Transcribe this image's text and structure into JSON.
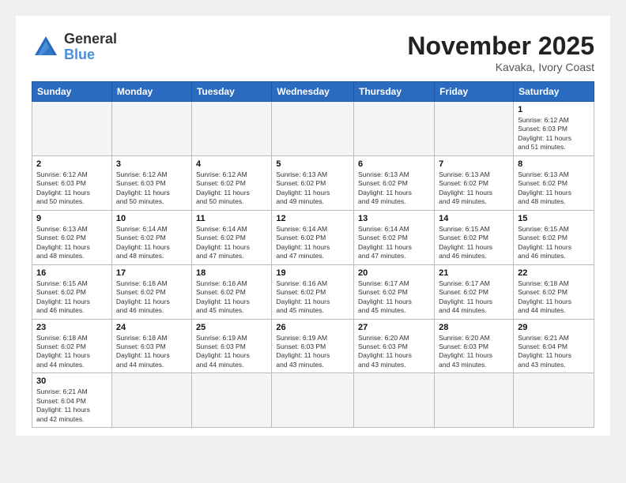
{
  "header": {
    "logo_general": "General",
    "logo_blue": "Blue",
    "month_title": "November 2025",
    "location": "Kavaka, Ivory Coast"
  },
  "weekdays": [
    "Sunday",
    "Monday",
    "Tuesday",
    "Wednesday",
    "Thursday",
    "Friday",
    "Saturday"
  ],
  "days": {
    "1": {
      "sunrise": "6:12 AM",
      "sunset": "6:03 PM",
      "daylight": "11 hours and 51 minutes."
    },
    "2": {
      "sunrise": "6:12 AM",
      "sunset": "6:03 PM",
      "daylight": "11 hours and 50 minutes."
    },
    "3": {
      "sunrise": "6:12 AM",
      "sunset": "6:03 PM",
      "daylight": "11 hours and 50 minutes."
    },
    "4": {
      "sunrise": "6:12 AM",
      "sunset": "6:02 PM",
      "daylight": "11 hours and 50 minutes."
    },
    "5": {
      "sunrise": "6:13 AM",
      "sunset": "6:02 PM",
      "daylight": "11 hours and 49 minutes."
    },
    "6": {
      "sunrise": "6:13 AM",
      "sunset": "6:02 PM",
      "daylight": "11 hours and 49 minutes."
    },
    "7": {
      "sunrise": "6:13 AM",
      "sunset": "6:02 PM",
      "daylight": "11 hours and 49 minutes."
    },
    "8": {
      "sunrise": "6:13 AM",
      "sunset": "6:02 PM",
      "daylight": "11 hours and 48 minutes."
    },
    "9": {
      "sunrise": "6:13 AM",
      "sunset": "6:02 PM",
      "daylight": "11 hours and 48 minutes."
    },
    "10": {
      "sunrise": "6:14 AM",
      "sunset": "6:02 PM",
      "daylight": "11 hours and 48 minutes."
    },
    "11": {
      "sunrise": "6:14 AM",
      "sunset": "6:02 PM",
      "daylight": "11 hours and 47 minutes."
    },
    "12": {
      "sunrise": "6:14 AM",
      "sunset": "6:02 PM",
      "daylight": "11 hours and 47 minutes."
    },
    "13": {
      "sunrise": "6:14 AM",
      "sunset": "6:02 PM",
      "daylight": "11 hours and 47 minutes."
    },
    "14": {
      "sunrise": "6:15 AM",
      "sunset": "6:02 PM",
      "daylight": "11 hours and 46 minutes."
    },
    "15": {
      "sunrise": "6:15 AM",
      "sunset": "6:02 PM",
      "daylight": "11 hours and 46 minutes."
    },
    "16": {
      "sunrise": "6:15 AM",
      "sunset": "6:02 PM",
      "daylight": "11 hours and 46 minutes."
    },
    "17": {
      "sunrise": "6:16 AM",
      "sunset": "6:02 PM",
      "daylight": "11 hours and 46 minutes."
    },
    "18": {
      "sunrise": "6:16 AM",
      "sunset": "6:02 PM",
      "daylight": "11 hours and 45 minutes."
    },
    "19": {
      "sunrise": "6:16 AM",
      "sunset": "6:02 PM",
      "daylight": "11 hours and 45 minutes."
    },
    "20": {
      "sunrise": "6:17 AM",
      "sunset": "6:02 PM",
      "daylight": "11 hours and 45 minutes."
    },
    "21": {
      "sunrise": "6:17 AM",
      "sunset": "6:02 PM",
      "daylight": "11 hours and 44 minutes."
    },
    "22": {
      "sunrise": "6:18 AM",
      "sunset": "6:02 PM",
      "daylight": "11 hours and 44 minutes."
    },
    "23": {
      "sunrise": "6:18 AM",
      "sunset": "6:02 PM",
      "daylight": "11 hours and 44 minutes."
    },
    "24": {
      "sunrise": "6:18 AM",
      "sunset": "6:03 PM",
      "daylight": "11 hours and 44 minutes."
    },
    "25": {
      "sunrise": "6:19 AM",
      "sunset": "6:03 PM",
      "daylight": "11 hours and 44 minutes."
    },
    "26": {
      "sunrise": "6:19 AM",
      "sunset": "6:03 PM",
      "daylight": "11 hours and 43 minutes."
    },
    "27": {
      "sunrise": "6:20 AM",
      "sunset": "6:03 PM",
      "daylight": "11 hours and 43 minutes."
    },
    "28": {
      "sunrise": "6:20 AM",
      "sunset": "6:03 PM",
      "daylight": "11 hours and 43 minutes."
    },
    "29": {
      "sunrise": "6:21 AM",
      "sunset": "6:04 PM",
      "daylight": "11 hours and 43 minutes."
    },
    "30": {
      "sunrise": "6:21 AM",
      "sunset": "6:04 PM",
      "daylight": "11 hours and 42 minutes."
    }
  }
}
